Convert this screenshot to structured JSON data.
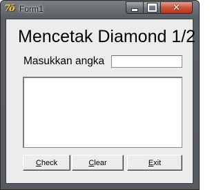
{
  "window": {
    "title": "Form1",
    "app_icon": "delphi-icon",
    "caption_buttons": {
      "minimize_icon": "minimize-icon",
      "maximize_icon": "maximize-icon",
      "close_icon": "close-icon",
      "close_color": "#c8533c"
    }
  },
  "form": {
    "heading": "Mencetak Diamond 1/2",
    "prompt_label": "Masukkan angka",
    "input_value": "",
    "memo_text": ""
  },
  "buttons": {
    "check_label": "Check",
    "clear_label": "Clear",
    "exit_label": "Exit"
  }
}
